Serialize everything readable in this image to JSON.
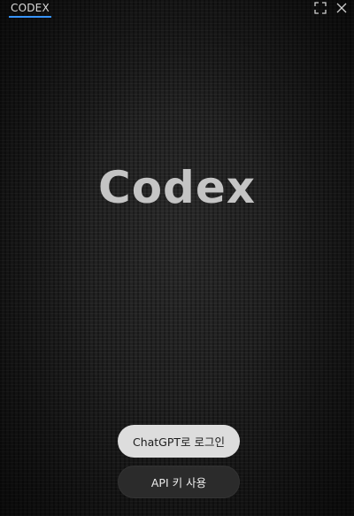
{
  "window": {
    "tab_label": "CODEX",
    "accent_color": "#3794ff"
  },
  "icons": {
    "expand": "expand-icon",
    "close": "close-icon"
  },
  "main": {
    "logo_text": "Codex"
  },
  "actions": {
    "chatgpt_login_label": "ChatGPT로 로그인",
    "api_key_label": "API 키 사용"
  }
}
